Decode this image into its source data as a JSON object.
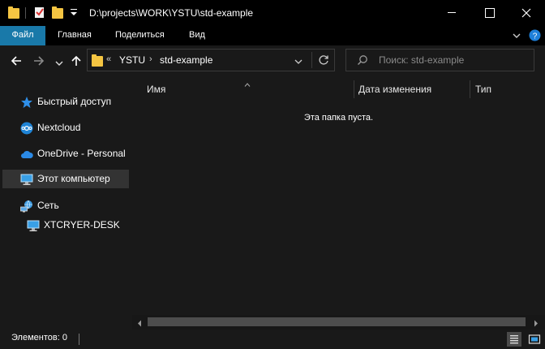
{
  "window": {
    "title": "D:\\projects\\WORK\\YSTU\\std-example"
  },
  "ribbon": {
    "tabs": [
      {
        "label": "Файл",
        "active": true
      },
      {
        "label": "Главная"
      },
      {
        "label": "Поделиться"
      },
      {
        "label": "Вид"
      }
    ]
  },
  "address": {
    "overflow": "«",
    "crumbs": [
      "YSTU",
      "std-example"
    ],
    "separator": "›"
  },
  "search": {
    "placeholder": "Поиск: std-example"
  },
  "sidebar": {
    "items": [
      {
        "label": "Быстрый доступ",
        "icon": "star-icon"
      },
      {
        "label": "Nextcloud",
        "icon": "nextcloud-icon"
      },
      {
        "label": "OneDrive - Personal",
        "icon": "cloud-icon"
      },
      {
        "label": "Этот компьютер",
        "icon": "computer-icon",
        "selected": true
      },
      {
        "label": "Сеть",
        "icon": "network-icon"
      },
      {
        "label": "XTCRYER-DESK",
        "icon": "desktop-icon"
      }
    ]
  },
  "columns": [
    "Имя",
    "Дата изменения",
    "Тип"
  ],
  "content": {
    "empty_message": "Эта папка пуста."
  },
  "status": {
    "items_text": "Элементов: 0"
  },
  "colors": {
    "accent": "#1979a9",
    "folder": "#f5c542",
    "background": "#191919",
    "titlebar": "#000000"
  }
}
